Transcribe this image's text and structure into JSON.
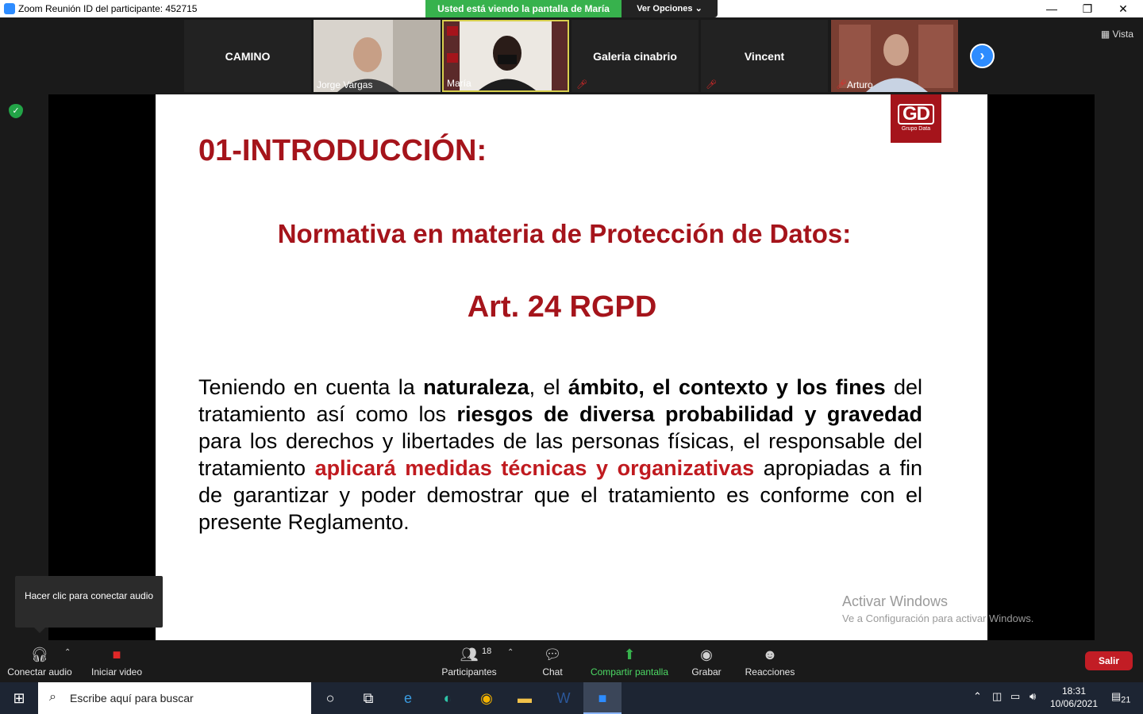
{
  "window": {
    "title": "Zoom Reunión ID del participante: 452715",
    "share_banner": "Usted está viendo la pantalla de María",
    "view_options": "Ver Opciones ⌄",
    "minimize": "—",
    "restore": "❐",
    "close": "✕"
  },
  "strip": {
    "tiles": [
      {
        "name": "CAMINO"
      },
      {
        "name": "Jorge Vargas"
      },
      {
        "name": "María"
      },
      {
        "name": "Galeria cinabrio"
      },
      {
        "name": "Vincent"
      },
      {
        "name": "Arturo"
      }
    ],
    "view_label": "Vista",
    "next_icon": "›"
  },
  "slide": {
    "logo_text": "GD",
    "logo_sub": "Grupo Data",
    "heading": "01-INTRODUCCIÓN:",
    "subheading": "Normativa en materia de Protección de Datos:",
    "article": "Art. 24 RGPD",
    "body": {
      "t1": "Teniendo en cuenta la ",
      "b1": "naturaleza",
      "t2": ", el ",
      "b2": "ámbito, el contexto y los fines",
      "t3": " del tratamiento así como los ",
      "b3": "riesgos de diversa probabilidad y gravedad",
      "t4": " para los derechos y libertades de las personas físicas, el responsable del tratamiento ",
      "r1": "aplicará medidas técnicas y organizativas",
      "t5": " apropiadas a fin de garantizar y poder demostrar que el tratamiento es conforme con el presente Reglamento."
    }
  },
  "watermark": {
    "line1": "Activar Windows",
    "line2": "Ve a Configuración para activar Windows."
  },
  "tooltip": "Hacer clic para conectar audio",
  "toolbar": {
    "audio": "Conectar audio",
    "video": "Iniciar video",
    "participants": "Participantes",
    "participants_count": "18",
    "chat": "Chat",
    "share": "Compartir pantalla",
    "record": "Grabar",
    "reactions": "Reacciones",
    "leave": "Salir"
  },
  "taskbar": {
    "search_placeholder": "Escribe aquí para buscar",
    "time": "18:31",
    "date": "10/06/2021",
    "notifications": "21"
  },
  "colors": {
    "slide_red": "#a5141b",
    "share_green": "#37b24d",
    "leave_red": "#c21d25",
    "accent_blue": "#2d8cff"
  }
}
